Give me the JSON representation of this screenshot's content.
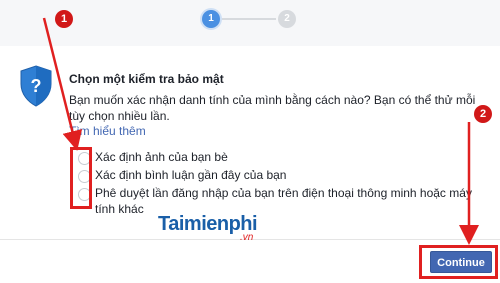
{
  "stepper": {
    "step1": "1",
    "step2": "2"
  },
  "security": {
    "title": "Chọn một kiểm tra bảo mật",
    "description": "Bạn muốn xác nhận danh tính của mình bằng cách nào? Bạn có thể thử mỗi tùy chọn nhiều lần.",
    "learn_more": "Tìm hiểu thêm",
    "options": [
      {
        "label": "Xác định ảnh của bạn bè"
      },
      {
        "label": "Xác định bình luận gần đây của bạn"
      },
      {
        "label": "Phê duyệt lần đăng nhập của bạn trên điện thoại thông minh hoặc máy tính khác"
      }
    ]
  },
  "footer": {
    "continue_label": "Continue"
  },
  "annotations": {
    "badge1": "1",
    "badge2": "2"
  },
  "watermark": {
    "brand": "Taimienphi",
    "suffix": ".vn"
  },
  "colors": {
    "accent": "#4267b2",
    "annotation": "#e02020",
    "step_active": "#4a90e2"
  }
}
